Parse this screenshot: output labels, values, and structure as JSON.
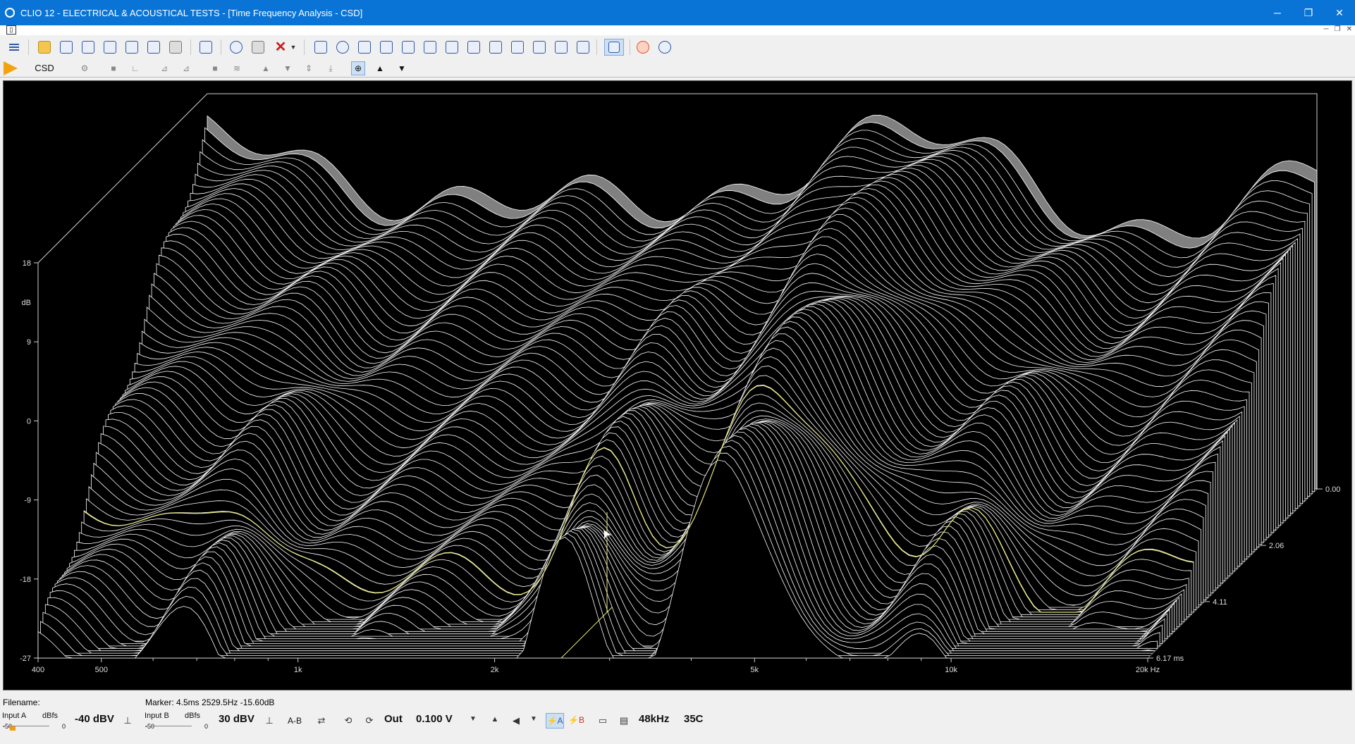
{
  "window": {
    "title": "CLIO 12 - ELECTRICAL & ACOUSTICAL TESTS - [Time Frequency Analysis - CSD]",
    "minimize": "─",
    "restore": "❐",
    "close": "✕"
  },
  "toolbar": {
    "icons": [
      "menu-icon",
      "open-icon",
      "save-icon",
      "save-as-icon",
      "export-icon",
      "import-icon",
      "notes-icon",
      "print-icon",
      "check-icon",
      "undo-icon",
      "eraser-icon",
      "delete-icon",
      "dropdown-icon",
      "mls-icon",
      "sinusoidal-icon",
      "fft-icon",
      "multimeter-icon",
      "thd-icon",
      "waterfall-icon",
      "sweep-icon",
      "rtaicon",
      "wf-icon",
      "leq-icon",
      "ruler-icon",
      "lr-icon",
      "qc-icon",
      "draw-icon",
      "help-icon",
      "web-help-icon"
    ]
  },
  "analysis_toolbar": {
    "mode_label": "CSD",
    "icons": [
      "play-icon",
      "settings-icon",
      "stop-icon",
      "reference-icon",
      "load-icon",
      "load-overlay-icon",
      "stop-gray-icon",
      "waterfall-gray-icon",
      "up-arrow-icon",
      "down-arrow-icon",
      "expand-icon",
      "compress-icon",
      "cursor-icon",
      "triangle-up-icon",
      "triangle-down-icon"
    ]
  },
  "chart_data": {
    "type": "area",
    "title": "",
    "y_axis": {
      "label": "dB",
      "ticks": [
        "18",
        "9",
        "0",
        "-9",
        "-18",
        "-27"
      ],
      "ylim": [
        -27,
        18
      ]
    },
    "x_axis": {
      "label": "Hz",
      "ticks": [
        "400",
        "500",
        "1k",
        "2k",
        "5k",
        "10k",
        "20k Hz"
      ],
      "scale": "log",
      "xlim": [
        400,
        20000
      ]
    },
    "z_axis": {
      "label": "ms",
      "ticks": [
        "0.00",
        "2.06",
        "4.11",
        "6.17 ms"
      ],
      "zlim": [
        0.0,
        6.17
      ]
    },
    "marker": {
      "time_ms": 4.5,
      "freq_hz": 2529.5,
      "level_db": -15.6
    },
    "background": "#000000",
    "surface_fill": "#808080",
    "line_color": "#ffffff",
    "marker_color": "#e8e87a",
    "grid": false
  },
  "status": {
    "filename_label": "Filename:",
    "marker_text": "Marker:  4.5ms  2529.5Hz  -15.60dB",
    "input_a_label": "Input A",
    "input_a_unit": "dBfs",
    "input_a_min": "-50",
    "input_a_max": "0",
    "input_a_range": "-40 dBV",
    "input_b_label": "Input B",
    "input_b_unit": "dBfs",
    "input_b_min": "-50",
    "input_b_max": "0",
    "input_b_range": "30 dBV",
    "ab_label": "A-B",
    "out_label": "Out",
    "out_value": "0.100 V",
    "sample_rate": "48kHz",
    "temperature": "35C"
  }
}
